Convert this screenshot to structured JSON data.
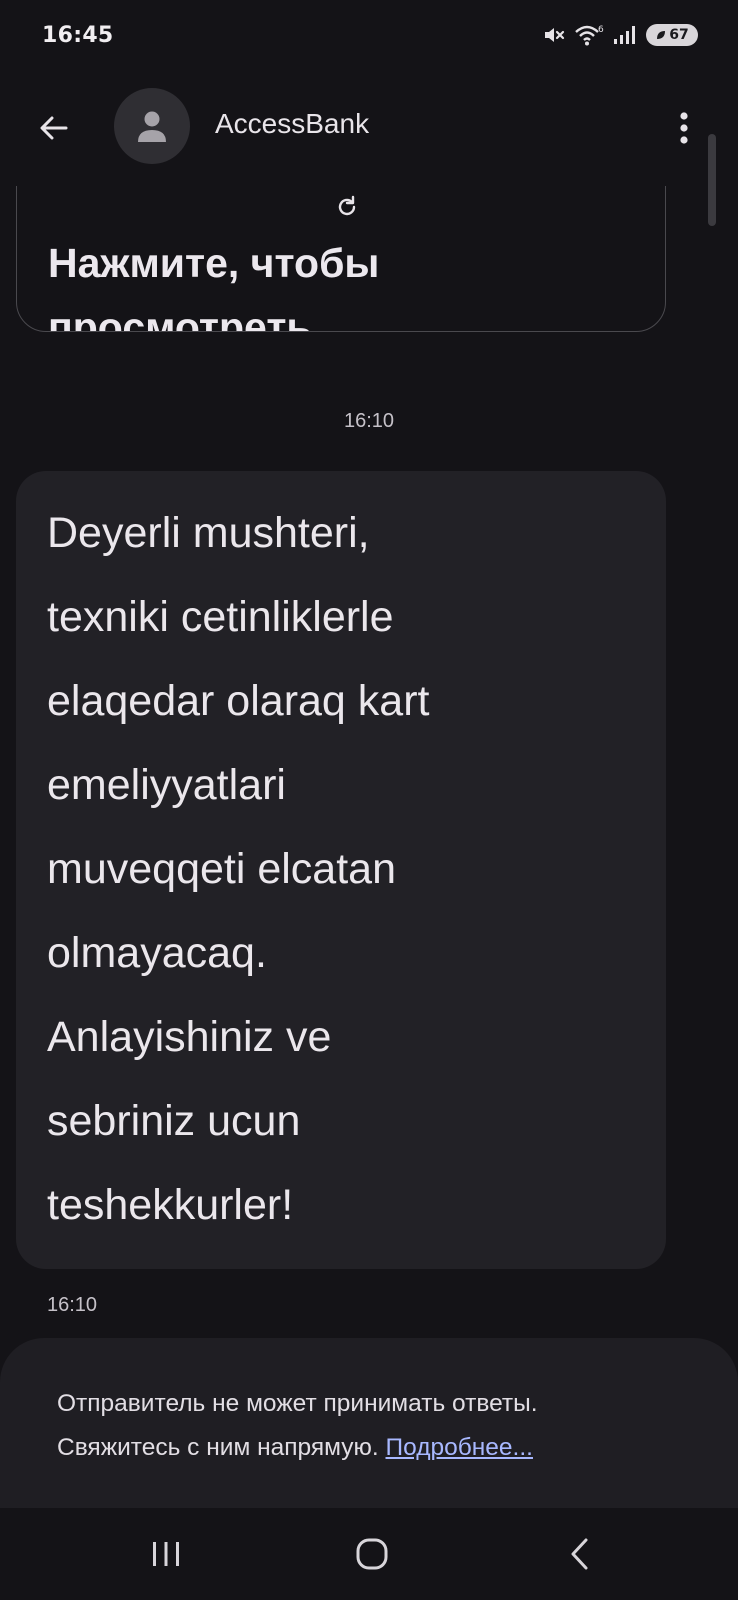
{
  "status_bar": {
    "time": "16:45",
    "battery_level": "67",
    "icons": [
      "mute-vibrate-icon",
      "wifi-6-icon",
      "signal-icon",
      "battery-saver-icon"
    ]
  },
  "app_bar": {
    "contact_name": "AccessBank",
    "icons": [
      "back-arrow-icon",
      "person-icon",
      "more-vert-icon"
    ]
  },
  "messages": {
    "previous_bubble_text": "Нажмите, чтобы просмотреть",
    "date_separator": "16:10",
    "message_text": "Deyerli mushteri,\ntexniki cetinliklerle\nelaqedar olaraq kart\nemeliyyatlari\nmuveqqeti elcatan\nolmayacaq.\nAnlayishiniz ve\nsebriniz ucun\nteshekkurler!",
    "message_time": "16:10"
  },
  "notice": {
    "line1": "Отправитель не может принимать ответы.",
    "line2": "Свяжитесь с ним напрямую.",
    "link": "Подробнее..."
  },
  "nav_bar": {
    "icons": [
      "recents-icon",
      "home-icon",
      "back-icon"
    ]
  },
  "colors": {
    "background": "#141317",
    "bubble": "#222126",
    "link": "#a8b8ff"
  }
}
